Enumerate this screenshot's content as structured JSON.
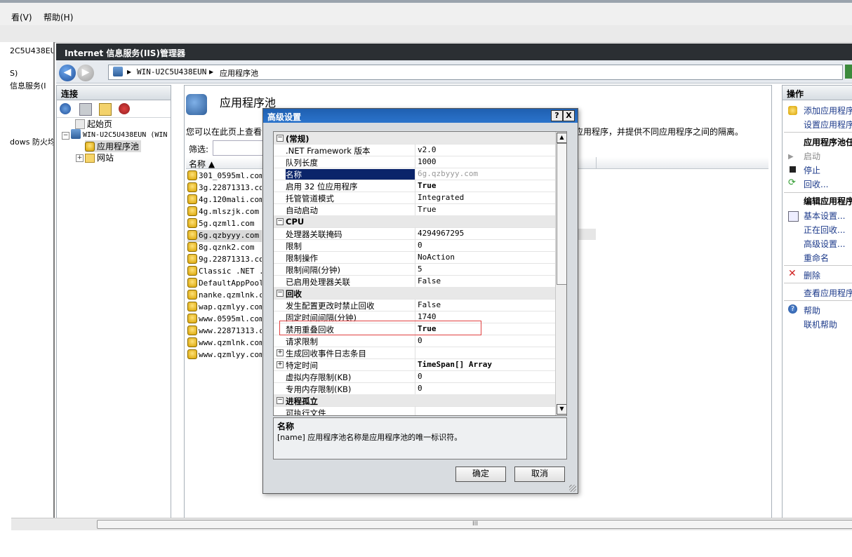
{
  "outer": {
    "menu_view": "看(V)",
    "menu_help": "帮助(H)",
    "left_texts": [
      "2C5U438EU",
      "S)",
      "信息服务(I",
      "dows 防火均"
    ]
  },
  "iis": {
    "title": "Internet 信息服务(IIS)管理器",
    "breadcrumb": [
      "WIN-U2C5U438EUN",
      "应用程序池"
    ]
  },
  "connections": {
    "header": "连接",
    "tree": {
      "start_page": "起始页",
      "server": "WIN-U2C5U438EUN (WIN",
      "app_pools": "应用程序池",
      "sites": "网站"
    }
  },
  "main": {
    "title": "应用程序池",
    "description_left": "您可以在此页上查看",
    "description_right": "应用程序，并提供不同应用程序之间的隔离。",
    "filter_label": "筛选:",
    "column_name": "名称 ▲",
    "pools": [
      "301_0595ml.com",
      "3g.22871313.com",
      "4g.120mali.com",
      "4g.mlszjk.com",
      "5g.qzml1.com",
      "6g.qzbyyy.com",
      "8g.qznk2.com",
      "9g.22871313.com",
      "Classic .NET ...",
      "DefaultAppPool",
      "nanke.qzmlnk.com",
      "wap.qzmlyy.com",
      "www.0595ml.com",
      "www.22871313.com",
      "www.qzmlnk.com",
      "www.qzmlyy.com"
    ],
    "selected_index": 5
  },
  "actions": {
    "header": "操作",
    "add_pool": "添加应用程序",
    "set_defaults": "设置应用程序",
    "pool_tasks": "应用程序池任",
    "start": "启动",
    "stop": "停止",
    "recycle": "回收...",
    "edit_pool": "编辑应用程序",
    "basic_settings": "基本设置...",
    "recycling": "正在回收...",
    "advanced_settings": "高级设置...",
    "rename": "重命名",
    "delete": "删除",
    "view_apps": "查看应用程序",
    "help": "帮助",
    "online_help": "联机帮助"
  },
  "dialog": {
    "title": "高级设置",
    "help_btn": "?",
    "close_btn": "X",
    "rows": [
      {
        "type": "cat",
        "label": "(常规)"
      },
      {
        "type": "prop",
        "label": ".NET Framework 版本",
        "value": "v2.0"
      },
      {
        "type": "prop",
        "label": "队列长度",
        "value": "1000"
      },
      {
        "type": "prop",
        "label": "名称",
        "value": "6g.qzbyyy.com",
        "selected": true
      },
      {
        "type": "prop",
        "label": "启用 32 位应用程序",
        "value": "True",
        "bold": true
      },
      {
        "type": "prop",
        "label": "托管管道模式",
        "value": "Integrated"
      },
      {
        "type": "prop",
        "label": "自动启动",
        "value": "True"
      },
      {
        "type": "cat",
        "label": "CPU"
      },
      {
        "type": "prop",
        "label": "处理器关联掩码",
        "value": "4294967295"
      },
      {
        "type": "prop",
        "label": "限制",
        "value": "0"
      },
      {
        "type": "prop",
        "label": "限制操作",
        "value": "NoAction"
      },
      {
        "type": "prop",
        "label": "限制间隔(分钟)",
        "value": "5"
      },
      {
        "type": "prop",
        "label": "已启用处理器关联",
        "value": "False"
      },
      {
        "type": "cat",
        "label": "回收"
      },
      {
        "type": "prop",
        "label": "发生配置更改时禁止回收",
        "value": "False"
      },
      {
        "type": "prop",
        "label": "固定时间间隔(分钟)",
        "value": "1740"
      },
      {
        "type": "prop",
        "label": "禁用重叠回收",
        "value": "True",
        "bold": true
      },
      {
        "type": "prop",
        "label": "请求限制",
        "value": "0"
      },
      {
        "type": "collapsed",
        "label": "生成回收事件日志条目",
        "value": ""
      },
      {
        "type": "collapsed",
        "label": "特定时间",
        "value": "TimeSpan[] Array",
        "bold": true
      },
      {
        "type": "prop",
        "label": "虚拟内存限制(KB)",
        "value": "0"
      },
      {
        "type": "prop",
        "label": "专用内存限制(KB)",
        "value": "0"
      },
      {
        "type": "cat",
        "label": "进程孤立"
      },
      {
        "type": "prop",
        "label": "可执行文件",
        "value": ""
      }
    ],
    "desc_name": "名称",
    "desc_text": "[name] 应用程序池名称是应用程序池的唯一标识符。",
    "ok": "确定",
    "cancel": "取消"
  },
  "scrollbar_grip": "III"
}
